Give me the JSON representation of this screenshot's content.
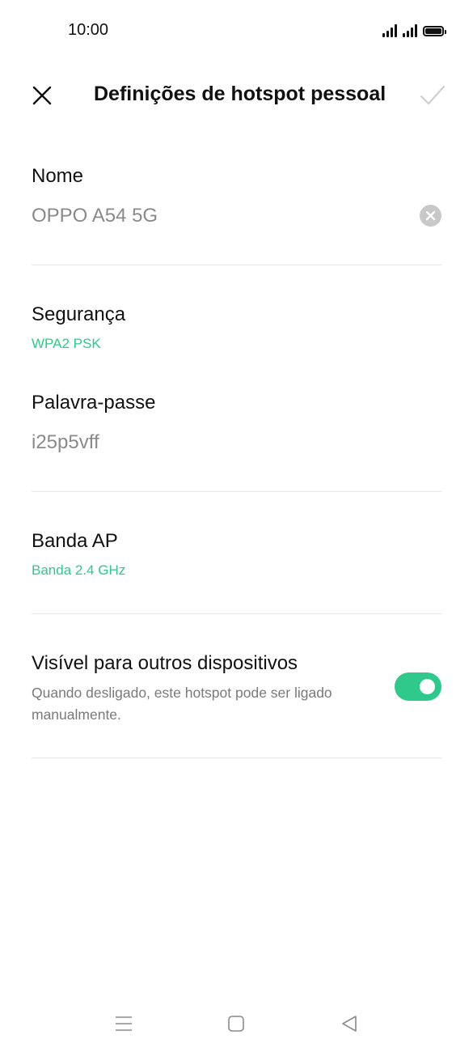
{
  "status_bar": {
    "time": "10:00",
    "icons": [
      "signal-icon",
      "signal-icon",
      "battery-icon"
    ]
  },
  "header": {
    "title": "Definições de hotspot pessoal",
    "close_icon": "close-icon",
    "confirm_icon": "check-icon"
  },
  "name_field": {
    "label": "Nome",
    "value": "OPPO A54 5G",
    "clear_icon": "clear-icon"
  },
  "security": {
    "label": "Segurança",
    "value": "WPA2 PSK"
  },
  "password": {
    "label": "Palavra-passe",
    "value": "i25p5vff"
  },
  "ap_band": {
    "label": "Banda AP",
    "value": "Banda 2.4 GHz"
  },
  "visibility": {
    "label": "Visível para outros dispositivos",
    "description": "Quando desligado, este hotspot pode ser ligado manualmente.",
    "enabled": true
  },
  "nav_bar": {
    "icons": [
      "menu-icon",
      "home-icon",
      "back-icon"
    ]
  },
  "colors": {
    "accent": "#2fc98b",
    "text_primary": "#111111",
    "text_secondary": "#8a8a8a",
    "divider": "#e6e6e6"
  }
}
